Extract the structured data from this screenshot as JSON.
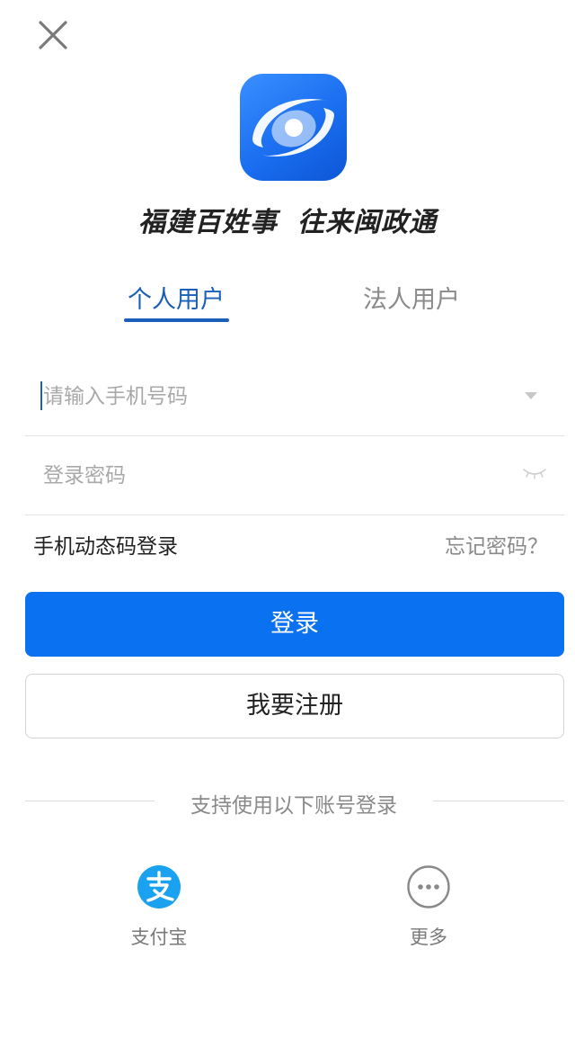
{
  "header": {
    "close_icon": "close-icon"
  },
  "brand": {
    "logo_icon": "app-logo-icon",
    "slogan_part1": "福建百姓事",
    "slogan_part2": "往来闽政通",
    "brand_color": "#1a6ef0"
  },
  "tabs": [
    {
      "label": "个人用户",
      "active": true
    },
    {
      "label": "法人用户",
      "active": false
    }
  ],
  "form": {
    "phone": {
      "value": "",
      "placeholder": "请输入手机号码",
      "icon": "chevron-down-icon"
    },
    "password": {
      "value": "",
      "placeholder": "登录密码",
      "icon": "eye-closed-icon"
    }
  },
  "links": {
    "sms_login": "手机动态码登录",
    "forgot_password": "忘记密码？"
  },
  "buttons": {
    "login": "登录",
    "register": "我要注册",
    "primary_color": "#0a72f0"
  },
  "third_party": {
    "divider_text": "支持使用以下账号登录",
    "options": [
      {
        "label": "支付宝",
        "icon": "alipay-icon",
        "color": "#1aa2f0"
      },
      {
        "label": "更多",
        "icon": "more-icon",
        "color": "#8a8a8a"
      }
    ]
  }
}
